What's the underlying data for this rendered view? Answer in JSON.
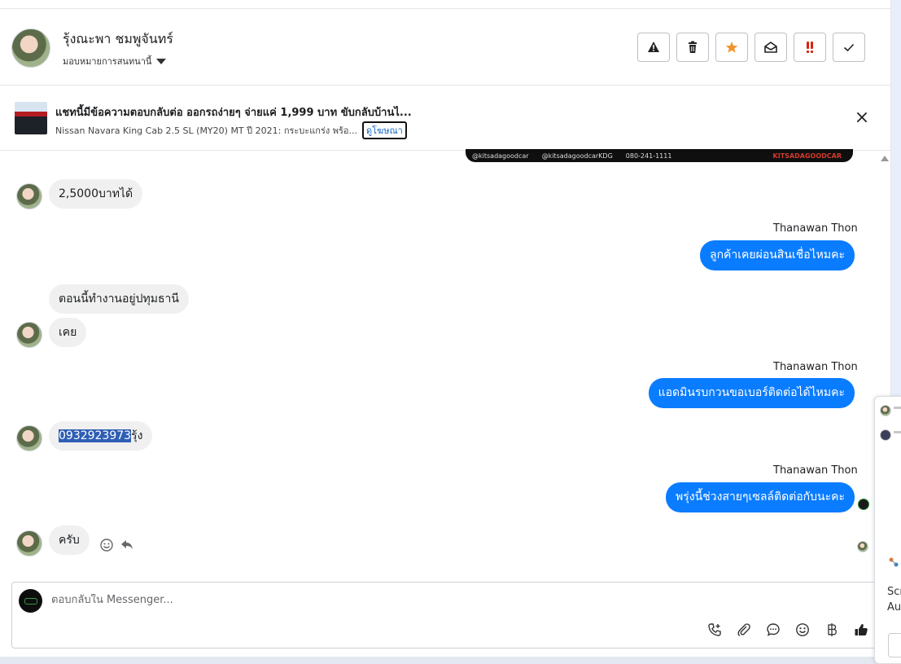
{
  "header": {
    "contact_name": "รุ้งณะพา ชมพูจันทร์",
    "assign_label": "มอบหมายการสนทนานี้",
    "actions": [
      {
        "name": "report-button",
        "icon": "warning-icon"
      },
      {
        "name": "delete-button",
        "icon": "trash-icon"
      },
      {
        "name": "star-button",
        "icon": "star-icon"
      },
      {
        "name": "mark-unread-button",
        "icon": "envelope-open-icon"
      },
      {
        "name": "priority-button",
        "icon": "double-exclamation-icon"
      },
      {
        "name": "mark-done-button",
        "icon": "check-icon"
      }
    ],
    "colors": {
      "star": "#f0932b",
      "priority": "#d9230f"
    }
  },
  "ad": {
    "title": "แชทนี้มีข้อความตอบกลับต่อ ออกรถง่ายๆ จ่ายแค่ 1,999 บาท ขับกลับบ้านไ...",
    "subtitle": "Nissan Navara King Cab 2.5 SL (MY20) MT ปี 2021: กระบะแกร่ง พร้อ...",
    "view_ad_link": "ดูโฆษณา"
  },
  "banner": {
    "handles": [
      "@kitsadagoodcar",
      "@kitsadagoodcarKDG",
      "080-241-1111"
    ],
    "brand": "KITSADAGOODCAR"
  },
  "messages": {
    "m1": "2,5000บาทได้",
    "s2": "Thanawan Thon",
    "m2": "ลูกค้าเคยผ่อนสินเชื่อไหมคะ",
    "m3": "ตอนนี้ทำงานอยู่ปทุมธานี",
    "m4": "เคย",
    "s5": "Thanawan Thon",
    "m5": "แอดมินรบกวนขอเบอร์ติดต่อได้ไหมคะ",
    "m6_highlight": "0932923973",
    "m6_rest": "รุ้ง",
    "s7": "Thanawan Thon",
    "m7": "พรุ่งนี้ช่วงสายๆเซลล์ติดต่อกับนะคะ",
    "m8": "ครับ"
  },
  "side_widget": {
    "line1": "Scr",
    "line2": "Au"
  },
  "composer": {
    "placeholder": "ตอบกลับใน Messenger...",
    "tools": [
      "phone-plus-icon",
      "paperclip-icon",
      "chat-bubble-icon",
      "emoji-icon",
      "baht-icon",
      "thumbs-up-icon"
    ]
  },
  "colors": {
    "outgoing_bubble": "#0a7cff",
    "incoming_bubble": "#f0f0f0",
    "highlight": "#2f5fb5"
  }
}
